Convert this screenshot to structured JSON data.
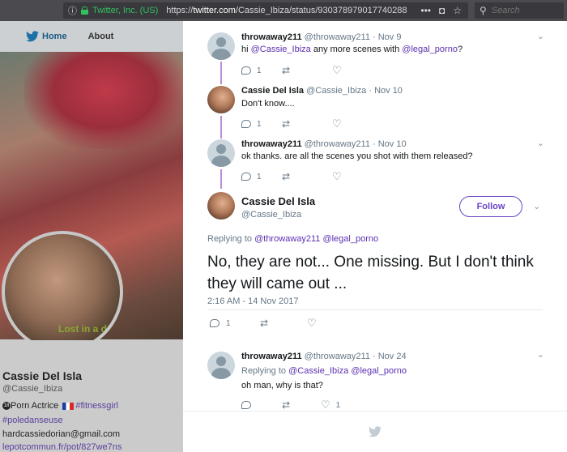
{
  "browser": {
    "site_identity": "Twitter, Inc. (US)",
    "url_prefix": "https://",
    "url_host": "twitter.com",
    "url_path": "/Cassie_Ibiza/status/930378979017740288",
    "menu_dots": "•••",
    "search_placeholder": "Search"
  },
  "background_page": {
    "nav": {
      "home": "Home",
      "about": "About"
    },
    "banner_text": "Lost in a d",
    "profile": {
      "name": "Cassie Del Isla",
      "handle": "@Cassie_Ibiza",
      "badge": "18",
      "bio_line1_text": "Porn Actrice",
      "bio_line1_tag": "#fitnessgirl",
      "bio_line2_tag": "#poledanseuse",
      "bio_line3": "hardcassiedorian@gmail.com",
      "bio_line4": "lepotcommun.fr/pot/827we7ns"
    }
  },
  "tweets": [
    {
      "name": "throwaway211",
      "handle": "@throwaway211",
      "date": "· Nov 9",
      "text_pre": "hi ",
      "mention1": "@Cassie_Ibiza",
      "text_mid": " any more scenes with ",
      "mention2": "@legal_porno",
      "text_post": "?",
      "replies": "1",
      "retweets": "",
      "likes": ""
    },
    {
      "name": "Cassie Del Isla",
      "handle": "@Cassie_Ibiza",
      "date": "· Nov 10",
      "text": "Don't know....",
      "replies": "1",
      "retweets": "",
      "likes": ""
    },
    {
      "name": "throwaway211",
      "handle": "@throwaway211",
      "date": "· Nov 10",
      "text": "ok thanks. are all the scenes you shot with them released?",
      "replies": "1",
      "retweets": "",
      "likes": ""
    }
  ],
  "main_tweet": {
    "name": "Cassie Del Isla",
    "handle": "@Cassie_Ibiza",
    "follow_label": "Follow",
    "replying_label": "Replying to ",
    "replying_to1": "@throwaway211",
    "replying_to2": "@legal_porno",
    "text": "No, they are not... One missing. But I don't think they will came out ...",
    "timestamp": "2:16 AM - 14 Nov 2017",
    "replies": "1",
    "retweets": "",
    "likes": ""
  },
  "reply_tweet": {
    "name": "throwaway211",
    "handle": "@throwaway211",
    "date": "· Nov 24",
    "replying_label": "Replying to ",
    "replying_to1": "@Cassie_Ibiza",
    "replying_to2": "@legal_porno",
    "text": "oh man, why is that?",
    "replies": "",
    "retweets": "",
    "likes": "1"
  },
  "icons": {
    "chevron": "⌄",
    "info": "ⓘ",
    "retweet": "⇄",
    "like": "♡",
    "search": "⚲",
    "star": "☆",
    "pocket": "◘"
  },
  "colors": {
    "link": "#5b2fb0",
    "thread_line": "#c08bd6",
    "follow": "#6b45c4",
    "secure": "#33c25e"
  }
}
